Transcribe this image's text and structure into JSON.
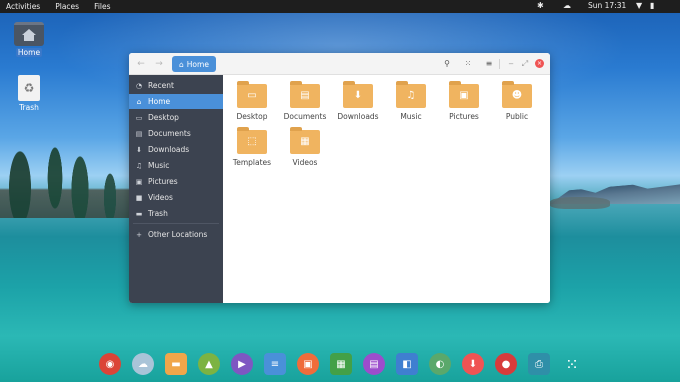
{
  "topbar": {
    "activities": "Activities",
    "places": "Places",
    "files": "Files",
    "clock": "Sun 17:31",
    "tray": {
      "accessibility_icon": "✱",
      "weather_icon": "☁",
      "wifi_icon": "▼",
      "battery_icon": "▮"
    }
  },
  "desktop": {
    "home_label": "Home",
    "trash_label": "Trash"
  },
  "window": {
    "back_icon": "←",
    "forward_icon": "→",
    "crumb_icon": "⌂",
    "crumb_label": "Home",
    "search_icon": "⚲",
    "view_icon": "⁙",
    "menu_icon": "≡",
    "minimize_icon": "‒",
    "maximize_icon": "⤢",
    "close_icon": "×"
  },
  "sidebar": {
    "items": [
      {
        "icon": "◔",
        "label": "Recent"
      },
      {
        "icon": "⌂",
        "label": "Home"
      },
      {
        "icon": "▭",
        "label": "Desktop"
      },
      {
        "icon": "▤",
        "label": "Documents"
      },
      {
        "icon": "⬇",
        "label": "Downloads"
      },
      {
        "icon": "♫",
        "label": "Music"
      },
      {
        "icon": "▣",
        "label": "Pictures"
      },
      {
        "icon": "■",
        "label": "Videos"
      },
      {
        "icon": "▬",
        "label": "Trash"
      },
      {
        "icon": "+",
        "label": "Other Locations"
      }
    ]
  },
  "folders": [
    {
      "glyph": "▭",
      "label": "Desktop"
    },
    {
      "glyph": "▤",
      "label": "Documents"
    },
    {
      "glyph": "⬇",
      "label": "Downloads"
    },
    {
      "glyph": "♫",
      "label": "Music"
    },
    {
      "glyph": "▣",
      "label": "Pictures"
    },
    {
      "glyph": "☻",
      "label": "Public"
    },
    {
      "glyph": "⬚",
      "label": "Templates"
    },
    {
      "glyph": "▦",
      "label": "Videos"
    }
  ],
  "dock": [
    {
      "name": "chrome-icon",
      "glyph": "◉",
      "color": "#db4437"
    },
    {
      "name": "weather-icon",
      "glyph": "☁",
      "color": "#a9c4d8"
    },
    {
      "name": "files-icon",
      "glyph": "▬",
      "color": "#f0a64a"
    },
    {
      "name": "image-viewer-icon",
      "glyph": "▲",
      "color": "#7cb342"
    },
    {
      "name": "video-player-icon",
      "glyph": "▶",
      "color": "#7e57c2"
    },
    {
      "name": "document-viewer-icon",
      "glyph": "≡",
      "color": "#4a90d9"
    },
    {
      "name": "presentation-icon",
      "glyph": "▣",
      "color": "#ef6c3b"
    },
    {
      "name": "spreadsheet-icon",
      "glyph": "▦",
      "color": "#43a047"
    },
    {
      "name": "text-editor-icon",
      "glyph": "▤",
      "color": "#9c4dcc"
    },
    {
      "name": "window-manager-icon",
      "glyph": "◧",
      "color": "#3f7fd0"
    },
    {
      "name": "settings-toggle-icon",
      "glyph": "◐",
      "color": "#5aa86b"
    },
    {
      "name": "software-installer-icon",
      "glyph": "⬇",
      "color": "#ef5454"
    },
    {
      "name": "screen-recorder-icon",
      "glyph": "●",
      "color": "#d83b3b"
    },
    {
      "name": "printer-icon",
      "glyph": "⎙",
      "color": "#2f8fa8"
    },
    {
      "name": "app-grid-icon",
      "glyph": "⁙",
      "color": "transparent"
    }
  ]
}
